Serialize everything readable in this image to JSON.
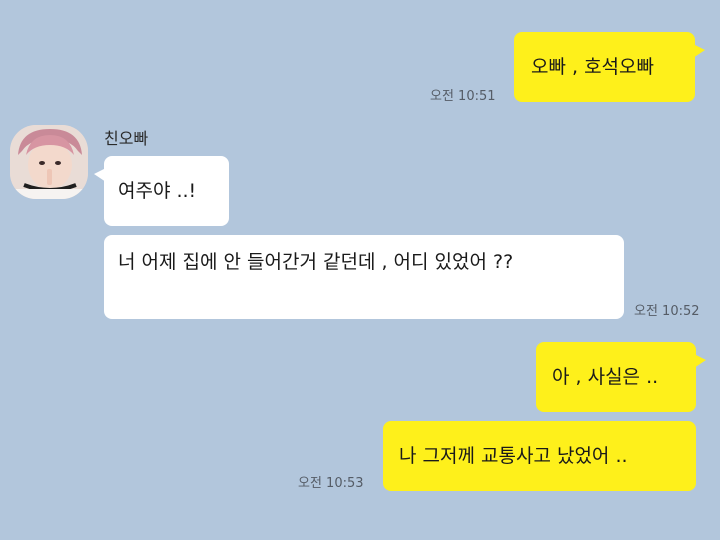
{
  "contact": {
    "name": "친오빠",
    "avatar": "profile-photo"
  },
  "messages": [
    {
      "from": "me",
      "text": "오빠 , 호석오빠",
      "time": "오전 10:51"
    },
    {
      "from": "other",
      "text": "여주야 ..!"
    },
    {
      "from": "other",
      "text": "너 어제 집에 안 들어간거 같던데 , 어디 있었어 ??",
      "time": "오전 10:52"
    },
    {
      "from": "me",
      "text": "아 , 사실은 .."
    },
    {
      "from": "me",
      "text": "나 그저께 교통사고 났었어 ..",
      "time": "오전 10:53"
    }
  ]
}
